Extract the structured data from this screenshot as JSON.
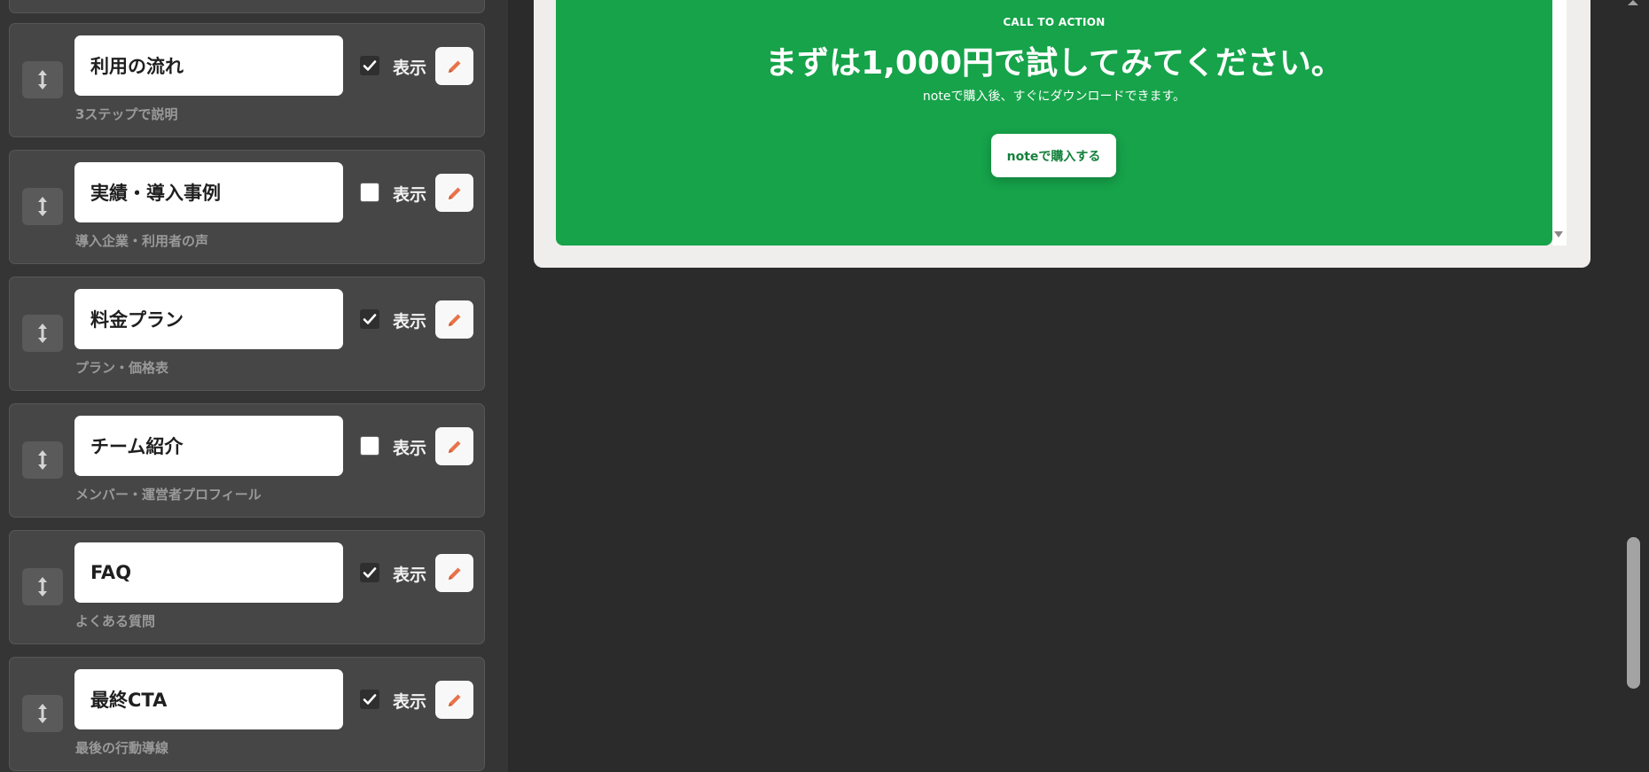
{
  "sidebar": {
    "show_label": "表示",
    "sections": [
      {
        "name": "利用の流れ",
        "desc": "3ステップで説明",
        "visible": true
      },
      {
        "name": "実績・導入事例",
        "desc": "導入企業・利用者の声",
        "visible": false
      },
      {
        "name": "料金プラン",
        "desc": "プラン・価格表",
        "visible": true
      },
      {
        "name": "チーム紹介",
        "desc": "メンバー・運営者プロフィール",
        "visible": false
      },
      {
        "name": "FAQ",
        "desc": "よくある質問",
        "visible": true
      },
      {
        "name": "最終CTA",
        "desc": "最後の行動導線",
        "visible": true
      }
    ]
  },
  "preview": {
    "cta": {
      "eyebrow": "CALL TO ACTION",
      "heading": "まずは1,000円で試してみてください。",
      "sub": "noteで購入後、すぐにダウンロードできます。",
      "button_label": "noteで購入する"
    }
  },
  "icons": {
    "drag": "drag-handle-icon",
    "edit": "pencil-icon",
    "check": "checkmark-icon"
  },
  "colors": {
    "cta_background": "#16a34a",
    "cta_button_text": "#15803d",
    "pencil": "#e8734a"
  }
}
